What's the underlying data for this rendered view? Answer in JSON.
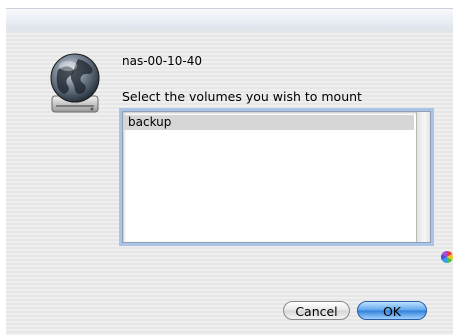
{
  "dialog": {
    "host_name": "nas-00-10-40",
    "prompt": "Select the volumes you wish to mount"
  },
  "volumes": {
    "items": [
      {
        "label": "backup",
        "selected": true
      }
    ]
  },
  "buttons": {
    "cancel_label": "Cancel",
    "ok_label": "OK"
  },
  "icons": {
    "server": "network-globe-server-icon",
    "spinner": "color-wheel-icon"
  },
  "colors": {
    "ok_button": "#3a8be0",
    "list_selection": "#d6d6d6",
    "focus_ring": "#a9c4e6"
  }
}
